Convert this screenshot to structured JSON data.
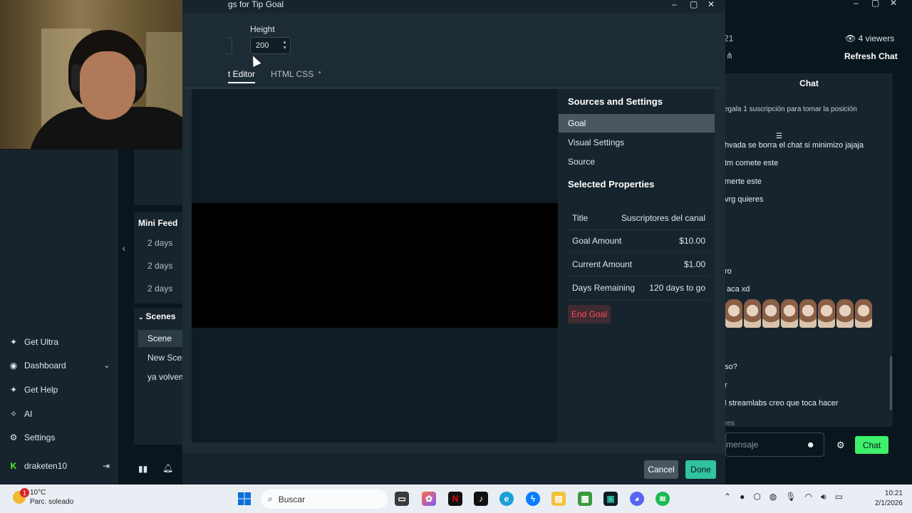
{
  "modal": {
    "title": "gs for Tip Goal",
    "height_label": "Height",
    "height_value": "200",
    "tabs": {
      "editor": "t Editor",
      "css": "HTML CSS"
    },
    "sources_heading": "Sources and Settings",
    "sources_items": [
      "Goal",
      "Visual Settings",
      "Source"
    ],
    "selected_heading": "Selected Properties",
    "properties": [
      {
        "label": "Title",
        "value": "Suscriptores del canal"
      },
      {
        "label": "Goal Amount",
        "value": "$10.00"
      },
      {
        "label": "Current Amount",
        "value": "$1.00"
      },
      {
        "label": "Days Remaining",
        "value": "120 days to go"
      }
    ],
    "end_goal": "End Goal",
    "cancel": "Cancel",
    "done": "Done"
  },
  "sidebar": {
    "items": [
      {
        "label": "Get Ultra",
        "icon": "ultra-icon"
      },
      {
        "label": "Dashboard",
        "icon": "dashboard-icon"
      },
      {
        "label": "Get Help",
        "icon": "help-icon"
      },
      {
        "label": "AI",
        "icon": "ai-icon"
      },
      {
        "label": "Settings",
        "icon": "gear-icon"
      }
    ],
    "user": "draketen10"
  },
  "mini_feed": {
    "title": "Mini Feed",
    "rows": [
      "2 days",
      "2 days",
      "2 days"
    ]
  },
  "scenes": {
    "title": "Scenes",
    "items": [
      "Scene",
      "New Scer",
      "ya volvem"
    ]
  },
  "chat": {
    "viewer_count": "21",
    "viewers": "4 viewers",
    "refresh": "Refresh Chat",
    "header": "Chat",
    "pinned": "egala 1 suscripción para tomar la posición",
    "lines": [
      "hvada se borra el chat si minimizo jajaja",
      "tm comete este",
      "merte este",
      "vrg quieres",
      "ro",
      "aca xd",
      "so?",
      "r",
      "l streamlabs creo que toca hacer",
      "res"
    ],
    "input_placeholder": "mensaje",
    "send": "Chat"
  },
  "taskbar": {
    "weather_temp": "10°C",
    "weather_desc": "Parc. soleado",
    "weather_badge": "1",
    "search": "Buscar",
    "time": "10:21",
    "date": "2/1/2026"
  },
  "colors": {
    "accent": "#31c3a2",
    "danger": "#ff4d5e",
    "panel": "#17242d",
    "background": "#09161d"
  }
}
